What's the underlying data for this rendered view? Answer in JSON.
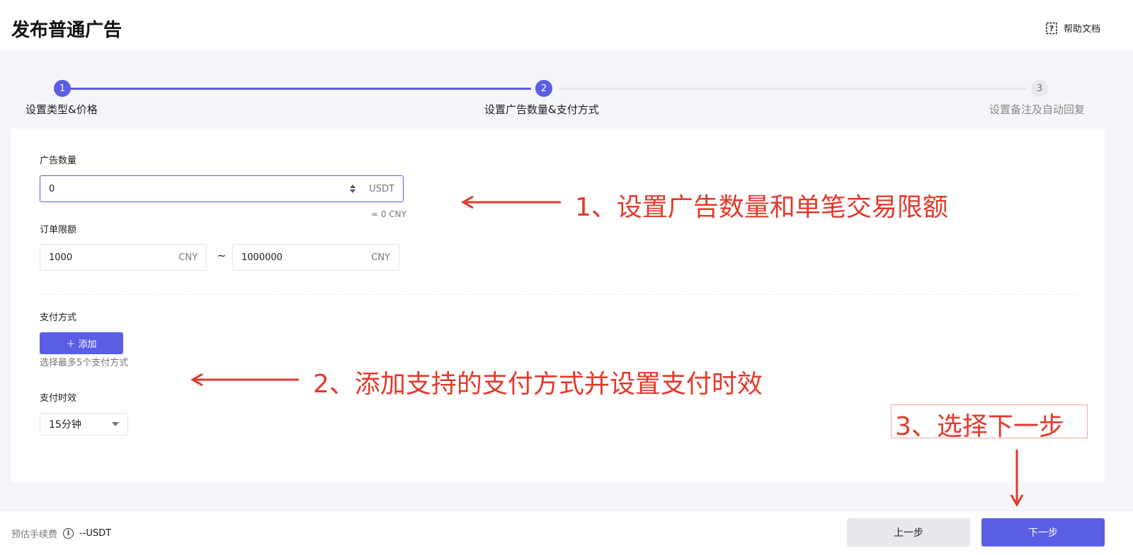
{
  "header": {
    "title": "发布普通广告",
    "help_label": "帮助文档"
  },
  "stepper": {
    "steps": [
      {
        "number": "1",
        "label": "设置类型&价格",
        "state": "done"
      },
      {
        "number": "2",
        "label": "设置广告数量&支付方式",
        "state": "active"
      },
      {
        "number": "3",
        "label": "设置备注及自动回复",
        "state": "pending"
      }
    ]
  },
  "form": {
    "ad_amount": {
      "label": "广告数量",
      "value": "0",
      "unit": "USDT",
      "approx": "≈ 0 CNY"
    },
    "order_limit": {
      "label": "订单限额",
      "min_value": "1000",
      "min_unit": "CNY",
      "separator": "~",
      "max_value": "1000000",
      "max_unit": "CNY"
    },
    "payment_method": {
      "label": "支付方式",
      "add_button": "添加",
      "add_icon": "＋",
      "hint": "选择最多5个支付方式"
    },
    "payment_time": {
      "label": "支付时效",
      "selected": "15分钟"
    }
  },
  "annotations": {
    "a1": "1、设置广告数量和单笔交易限额",
    "a2": "2、添加支持的支付方式并设置支付时效",
    "a3": "3、选择下一步",
    "color": "#e23a2c"
  },
  "footer": {
    "fee_label": "预估手续费",
    "fee_value": "--USDT",
    "prev_button": "上一步",
    "next_button": "下一步"
  },
  "colors": {
    "primary": "#5a5ee5",
    "annotation": "#e23a2c"
  }
}
